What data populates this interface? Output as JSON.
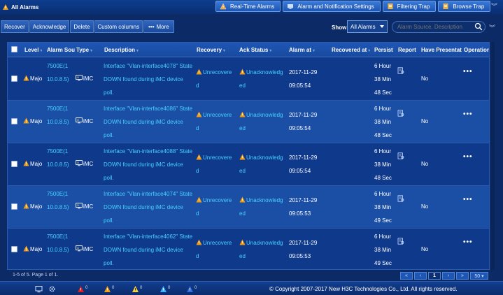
{
  "window": {
    "title": "All Alarms"
  },
  "top_tabs": [
    {
      "label": "Real-Time Alarms",
      "icon": "warning-bell-icon"
    },
    {
      "label": "Alarm and Notification Settings",
      "icon": "settings-monitor-icon"
    },
    {
      "label": "Filtering Trap",
      "icon": "filter-icon"
    },
    {
      "label": "Browse Trap",
      "icon": "browse-icon"
    }
  ],
  "toolbar": {
    "recover": "Recover",
    "acknowledge": "Acknowledge",
    "delete": "Delete",
    "custom_columns": "Custom columns",
    "more": "More",
    "more_dots": "•••",
    "show_label": "Show",
    "show_value": "All Alarms",
    "search_placeholder": "Alarm Source, Description"
  },
  "columns": {
    "level": "Level",
    "alarm_source": "Alarm Sou",
    "type": "Type",
    "description": "Description",
    "recovery": "Recovery",
    "ack_status": "Ack Status",
    "alarm_at": "Alarm at",
    "recovered_at": "Recovered at",
    "persist": "Persist",
    "report": "Report",
    "have_presentation": "Have Presentat",
    "operations": "Operations"
  },
  "rows": [
    {
      "level": "Majo",
      "source_1": "7500E(1",
      "source_2": "10.0.8.5)",
      "type": "iMC",
      "desc_1": "Interface \"Vlan-interface4078\" State",
      "desc_2": "DOWN found during iMC device",
      "desc_3": "poll.",
      "recovery_1": "Unrecovere",
      "recovery_2": "d",
      "ack_1": "Unacknowledg",
      "ack_2": "ed",
      "alarm_date": "2017-11-29",
      "alarm_time": "09:05:54",
      "recovered_at": "",
      "persist_1": "6 Hour",
      "persist_2": "38 Min",
      "persist_3": "48 Sec",
      "presentation": "No",
      "ops": "•••"
    },
    {
      "level": "Majo",
      "source_1": "7500E(1",
      "source_2": "10.0.8.5)",
      "type": "iMC",
      "desc_1": "Interface \"Vlan-interface4086\" State",
      "desc_2": "DOWN found during iMC device",
      "desc_3": "poll.",
      "recovery_1": "Unrecovere",
      "recovery_2": "d",
      "ack_1": "Unacknowledg",
      "ack_2": "ed",
      "alarm_date": "2017-11-29",
      "alarm_time": "09:05:54",
      "recovered_at": "",
      "persist_1": "6 Hour",
      "persist_2": "38 Min",
      "persist_3": "48 Sec",
      "presentation": "No",
      "ops": "•••"
    },
    {
      "level": "Majo",
      "source_1": "7500E(1",
      "source_2": "10.0.8.5)",
      "type": "iMC",
      "desc_1": "Interface \"Vlan-interface4088\" State",
      "desc_2": "DOWN found during iMC device",
      "desc_3": "poll.",
      "recovery_1": "Unrecovere",
      "recovery_2": "d",
      "ack_1": "Unacknowledg",
      "ack_2": "ed",
      "alarm_date": "2017-11-29",
      "alarm_time": "09:05:54",
      "recovered_at": "",
      "persist_1": "6 Hour",
      "persist_2": "38 Min",
      "persist_3": "48 Sec",
      "presentation": "No",
      "ops": "•••"
    },
    {
      "level": "Majo",
      "source_1": "7500E(1",
      "source_2": "10.0.8.5)",
      "type": "iMC",
      "desc_1": "Interface \"Vlan-interface4074\" State",
      "desc_2": "DOWN found during iMC device",
      "desc_3": "poll.",
      "recovery_1": "Unrecovere",
      "recovery_2": "d",
      "ack_1": "Unacknowledg",
      "ack_2": "ed",
      "alarm_date": "2017-11-29",
      "alarm_time": "09:05:53",
      "recovered_at": "",
      "persist_1": "6 Hour",
      "persist_2": "38 Min",
      "persist_3": "49 Sec",
      "presentation": "No",
      "ops": "•••"
    },
    {
      "level": "Majo",
      "source_1": "7500E(1",
      "source_2": "10.0.8.5)",
      "type": "iMC",
      "desc_1": "Interface \"Vlan-interface4062\" State",
      "desc_2": "DOWN found during iMC device",
      "desc_3": "poll.",
      "recovery_1": "Unrecovere",
      "recovery_2": "d",
      "ack_1": "Unacknowledg",
      "ack_2": "ed",
      "alarm_date": "2017-11-29",
      "alarm_time": "09:05:53",
      "recovered_at": "",
      "persist_1": "6 Hour",
      "persist_2": "38 Min",
      "persist_3": "49 Sec",
      "presentation": "No",
      "ops": "•••"
    }
  ],
  "pager": {
    "summary": "1-5 of 5. Page 1 of 1.",
    "first": "«",
    "prev": "‹",
    "current": "1",
    "next": "›",
    "last": "»",
    "page_size": "50 ▾"
  },
  "footer": {
    "copyright": "© Copyright 2007-2017 New H3C Technologies Co., Ltd. All rights reserved.",
    "counts": [
      "0",
      "0",
      "0",
      "0",
      "0"
    ]
  },
  "colors": {
    "background": "#0b2a66",
    "link": "#48d0ff",
    "critical": "#e02020",
    "major": "#f39c12",
    "minor": "#f4d03f",
    "warning": "#3ab0ff",
    "info": "#2c6ee0"
  }
}
